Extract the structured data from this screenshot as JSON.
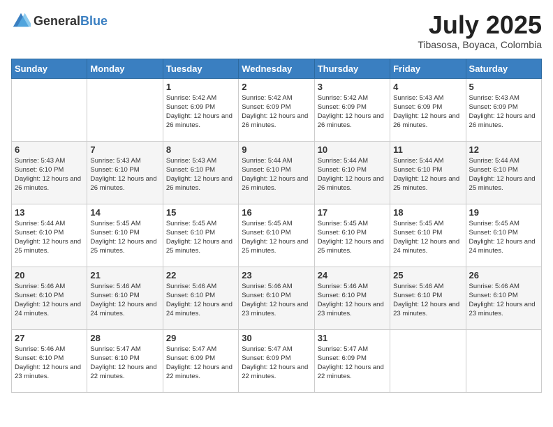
{
  "logo": {
    "text_general": "General",
    "text_blue": "Blue"
  },
  "header": {
    "month_year": "July 2025",
    "location": "Tibasosa, Boyaca, Colombia"
  },
  "days_of_week": [
    "Sunday",
    "Monday",
    "Tuesday",
    "Wednesday",
    "Thursday",
    "Friday",
    "Saturday"
  ],
  "weeks": [
    [
      {
        "day": "",
        "info": ""
      },
      {
        "day": "",
        "info": ""
      },
      {
        "day": "1",
        "info": "Sunrise: 5:42 AM\nSunset: 6:09 PM\nDaylight: 12 hours and 26 minutes."
      },
      {
        "day": "2",
        "info": "Sunrise: 5:42 AM\nSunset: 6:09 PM\nDaylight: 12 hours and 26 minutes."
      },
      {
        "day": "3",
        "info": "Sunrise: 5:42 AM\nSunset: 6:09 PM\nDaylight: 12 hours and 26 minutes."
      },
      {
        "day": "4",
        "info": "Sunrise: 5:43 AM\nSunset: 6:09 PM\nDaylight: 12 hours and 26 minutes."
      },
      {
        "day": "5",
        "info": "Sunrise: 5:43 AM\nSunset: 6:09 PM\nDaylight: 12 hours and 26 minutes."
      }
    ],
    [
      {
        "day": "6",
        "info": "Sunrise: 5:43 AM\nSunset: 6:10 PM\nDaylight: 12 hours and 26 minutes."
      },
      {
        "day": "7",
        "info": "Sunrise: 5:43 AM\nSunset: 6:10 PM\nDaylight: 12 hours and 26 minutes."
      },
      {
        "day": "8",
        "info": "Sunrise: 5:43 AM\nSunset: 6:10 PM\nDaylight: 12 hours and 26 minutes."
      },
      {
        "day": "9",
        "info": "Sunrise: 5:44 AM\nSunset: 6:10 PM\nDaylight: 12 hours and 26 minutes."
      },
      {
        "day": "10",
        "info": "Sunrise: 5:44 AM\nSunset: 6:10 PM\nDaylight: 12 hours and 26 minutes."
      },
      {
        "day": "11",
        "info": "Sunrise: 5:44 AM\nSunset: 6:10 PM\nDaylight: 12 hours and 25 minutes."
      },
      {
        "day": "12",
        "info": "Sunrise: 5:44 AM\nSunset: 6:10 PM\nDaylight: 12 hours and 25 minutes."
      }
    ],
    [
      {
        "day": "13",
        "info": "Sunrise: 5:44 AM\nSunset: 6:10 PM\nDaylight: 12 hours and 25 minutes."
      },
      {
        "day": "14",
        "info": "Sunrise: 5:45 AM\nSunset: 6:10 PM\nDaylight: 12 hours and 25 minutes."
      },
      {
        "day": "15",
        "info": "Sunrise: 5:45 AM\nSunset: 6:10 PM\nDaylight: 12 hours and 25 minutes."
      },
      {
        "day": "16",
        "info": "Sunrise: 5:45 AM\nSunset: 6:10 PM\nDaylight: 12 hours and 25 minutes."
      },
      {
        "day": "17",
        "info": "Sunrise: 5:45 AM\nSunset: 6:10 PM\nDaylight: 12 hours and 25 minutes."
      },
      {
        "day": "18",
        "info": "Sunrise: 5:45 AM\nSunset: 6:10 PM\nDaylight: 12 hours and 24 minutes."
      },
      {
        "day": "19",
        "info": "Sunrise: 5:45 AM\nSunset: 6:10 PM\nDaylight: 12 hours and 24 minutes."
      }
    ],
    [
      {
        "day": "20",
        "info": "Sunrise: 5:46 AM\nSunset: 6:10 PM\nDaylight: 12 hours and 24 minutes."
      },
      {
        "day": "21",
        "info": "Sunrise: 5:46 AM\nSunset: 6:10 PM\nDaylight: 12 hours and 24 minutes."
      },
      {
        "day": "22",
        "info": "Sunrise: 5:46 AM\nSunset: 6:10 PM\nDaylight: 12 hours and 24 minutes."
      },
      {
        "day": "23",
        "info": "Sunrise: 5:46 AM\nSunset: 6:10 PM\nDaylight: 12 hours and 23 minutes."
      },
      {
        "day": "24",
        "info": "Sunrise: 5:46 AM\nSunset: 6:10 PM\nDaylight: 12 hours and 23 minutes."
      },
      {
        "day": "25",
        "info": "Sunrise: 5:46 AM\nSunset: 6:10 PM\nDaylight: 12 hours and 23 minutes."
      },
      {
        "day": "26",
        "info": "Sunrise: 5:46 AM\nSunset: 6:10 PM\nDaylight: 12 hours and 23 minutes."
      }
    ],
    [
      {
        "day": "27",
        "info": "Sunrise: 5:46 AM\nSunset: 6:10 PM\nDaylight: 12 hours and 23 minutes."
      },
      {
        "day": "28",
        "info": "Sunrise: 5:47 AM\nSunset: 6:10 PM\nDaylight: 12 hours and 22 minutes."
      },
      {
        "day": "29",
        "info": "Sunrise: 5:47 AM\nSunset: 6:09 PM\nDaylight: 12 hours and 22 minutes."
      },
      {
        "day": "30",
        "info": "Sunrise: 5:47 AM\nSunset: 6:09 PM\nDaylight: 12 hours and 22 minutes."
      },
      {
        "day": "31",
        "info": "Sunrise: 5:47 AM\nSunset: 6:09 PM\nDaylight: 12 hours and 22 minutes."
      },
      {
        "day": "",
        "info": ""
      },
      {
        "day": "",
        "info": ""
      }
    ]
  ]
}
